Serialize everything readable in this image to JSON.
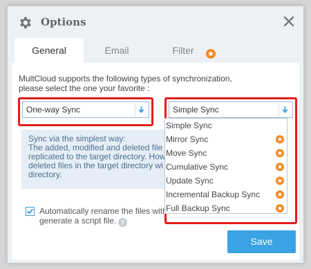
{
  "dialog": {
    "title": "Options",
    "close_label": "✕"
  },
  "tabs": [
    {
      "label": "General",
      "active": true
    },
    {
      "label": "Email",
      "active": false
    },
    {
      "label": "Filter",
      "active": false,
      "badge": "star-icon"
    }
  ],
  "general": {
    "intro_line1": "MultCloud supports the following types of synchronization,",
    "intro_line2": "please select the one your favorite :",
    "direction_select": {
      "value": "One-way Sync"
    },
    "mode_select": {
      "value": "Simple Sync"
    },
    "info": {
      "heading": "Sync via the simplest way:",
      "line1": "The added, modified and deleted file",
      "line2": "replicated to the target directory. How",
      "line3": "deleted files in the target directory wi",
      "line4": "directory."
    },
    "auto_rename": {
      "checked": true,
      "line1": "Automatically rename the files with",
      "line2": "generate a script file."
    }
  },
  "sync_mode_options": [
    {
      "label": "Simple Sync",
      "premium": false
    },
    {
      "label": "Mirror Sync",
      "premium": true
    },
    {
      "label": "Move Sync",
      "premium": true
    },
    {
      "label": "Cumulative Sync",
      "premium": true
    },
    {
      "label": "Update Sync",
      "premium": true
    },
    {
      "label": "Incremental Backup Sync",
      "premium": true
    },
    {
      "label": "Full Backup Sync",
      "premium": true
    }
  ],
  "footer": {
    "save_label": "Save"
  },
  "colors": {
    "accent": "#3aa3e3",
    "highlight_border": "#e41b1b",
    "premium_star": "#f08a24",
    "info_bg": "#e5eef6"
  }
}
